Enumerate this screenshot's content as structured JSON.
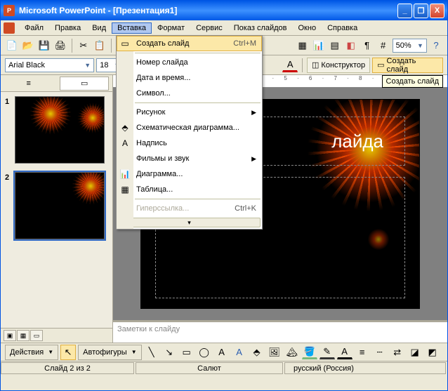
{
  "window": {
    "title": "Microsoft PowerPoint - [Презентация1]",
    "min": "_",
    "max": "❐",
    "close": "X"
  },
  "menu": {
    "file": "Файл",
    "edit": "Правка",
    "view": "Вид",
    "insert": "Вставка",
    "format": "Формат",
    "tools": "Сервис",
    "slideshow": "Показ слайдов",
    "window": "Окно",
    "help": "Справка"
  },
  "toolbar": {
    "zoom": "50%",
    "font": "Arial Black",
    "size": "18",
    "designer": "Конструктор",
    "new_slide": "Создать слайд",
    "tooltip": "Создать слайд"
  },
  "tabs": {
    "outline": "≡",
    "slides": "▭"
  },
  "thumbs": [
    {
      "num": "1"
    },
    {
      "num": "2"
    }
  ],
  "ruler": "2 · 1 · 1 · 2 · 3 · 4 · 5 · 6 · 7 · 8 · 9 · 10 · 11 · 12",
  "slide": {
    "title_fragment": "лайда"
  },
  "notes_placeholder": "Заметки к слайду",
  "drawbar": {
    "actions": "Действия",
    "autoshapes": "Автофигуры"
  },
  "status": {
    "slide": "Слайд 2 из 2",
    "template": "Салют",
    "lang": "русский (Россия)"
  },
  "dropdown": {
    "new_slide": "Создать слайд",
    "new_slide_sc": "Ctrl+M",
    "slide_number": "Номер слайда",
    "date_time": "Дата и время...",
    "symbol": "Символ...",
    "picture": "Рисунок",
    "diagram": "Схематическая диаграмма...",
    "textbox": "Надпись",
    "movies": "Фильмы и звук",
    "chart": "Диаграмма...",
    "table": "Таблица...",
    "hyperlink": "Гиперссылка...",
    "hyperlink_sc": "Ctrl+K"
  },
  "chart_data": null
}
